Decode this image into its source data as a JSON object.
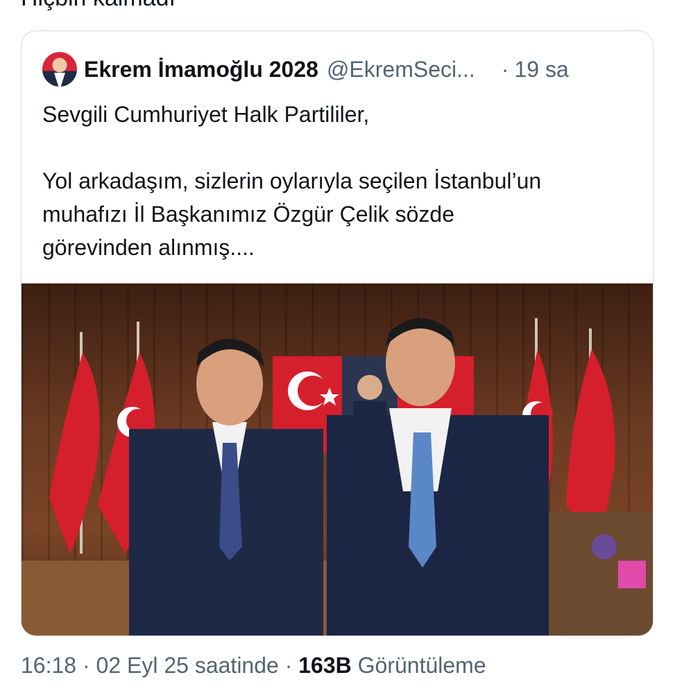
{
  "parent_tweet": {
    "text": "Hiçbiri kalmadı"
  },
  "quoted_tweet": {
    "author_name": "Ekrem İmamoğlu 2028",
    "handle": "@EkremSeci...",
    "separator": "·",
    "time_ago": "19 sa",
    "lines": [
      "Sevgili Cumhuriyet Halk Partililer,",
      "Yol arkadaşım, sizlerin oylarıyla seçilen İstanbul’un",
      "muhafızı İl Başkanımız Özgür Çelik sözde",
      "görevinden alınmış...."
    ]
  },
  "meta": {
    "time": "16:18",
    "sep1": "·",
    "date": "02 Eyl 25 saatinde",
    "sep2": "·",
    "views_count": "163B",
    "views_label": "Görüntüleme"
  },
  "colors": {
    "text": "#0f1419",
    "secondary": "#536471",
    "border": "#cfd9de",
    "flag_red": "#d61f2c"
  }
}
